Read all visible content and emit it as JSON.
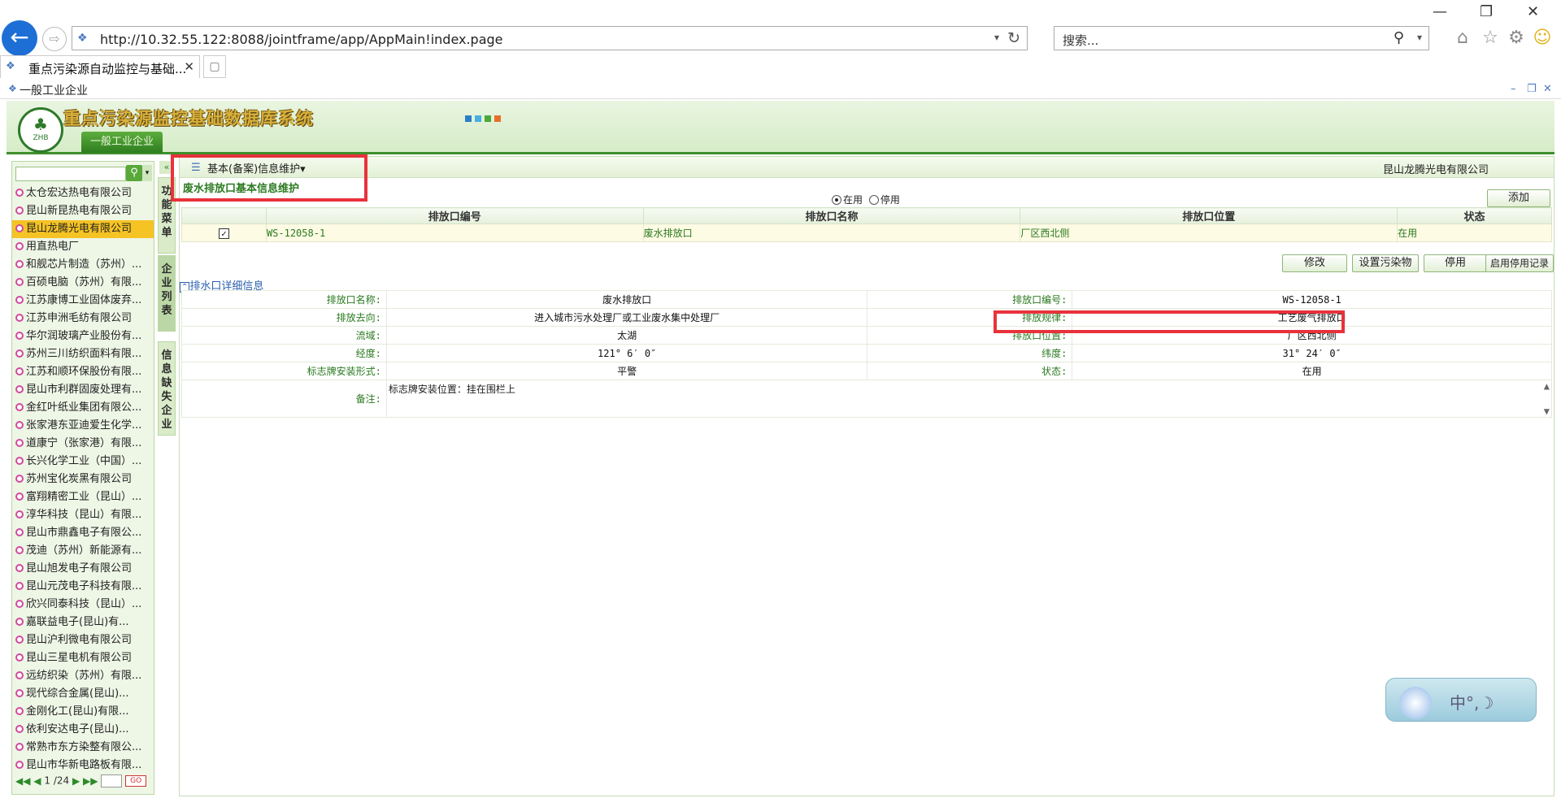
{
  "browser": {
    "url": "http://10.32.55.122:8088/jointframe/app/AppMain!index.page",
    "search_placeholder": "搜索...",
    "tab_title": "重点污染源自动监控与基础...",
    "back_glyph": "←",
    "forward_glyph": "⇨"
  },
  "app": {
    "window_title": "一般工业企业",
    "system_title": "重点污染源监控基础数据库系统",
    "logo_text": "ZHB",
    "module_tab": "一般工业企业"
  },
  "sidebar": {
    "items": [
      {
        "label": "太仓宏达热电有限公司"
      },
      {
        "label": "昆山新昆热电有限公司"
      },
      {
        "label": "昆山龙腾光电有限公司",
        "selected": true
      },
      {
        "label": "用直热电厂"
      },
      {
        "label": "和舰芯片制造（苏州）..."
      },
      {
        "label": "百硕电脑（苏州）有限..."
      },
      {
        "label": "江苏康博工业固体废弃..."
      },
      {
        "label": "江苏申洲毛纺有限公司"
      },
      {
        "label": "华尔润玻璃产业股份有..."
      },
      {
        "label": "苏州三川纺织面料有限..."
      },
      {
        "label": "江苏和顺环保股份有限..."
      },
      {
        "label": "昆山市利群固废处理有..."
      },
      {
        "label": "金红叶纸业集团有限公..."
      },
      {
        "label": "张家港东亚迪爱生化学..."
      },
      {
        "label": "道康宁（张家港）有限..."
      },
      {
        "label": "长兴化学工业（中国）..."
      },
      {
        "label": "苏州宝化炭黑有限公司"
      },
      {
        "label": "富翔精密工业（昆山）..."
      },
      {
        "label": "淳华科技（昆山）有限..."
      },
      {
        "label": "昆山市鼎鑫电子有限公..."
      },
      {
        "label": "茂迪（苏州）新能源有..."
      },
      {
        "label": "昆山旭发电子有限公司"
      },
      {
        "label": "昆山元茂电子科技有限..."
      },
      {
        "label": "欣兴同泰科技（昆山）..."
      },
      {
        "label": "嘉联益电子(昆山)有..."
      },
      {
        "label": "昆山沪利微电有限公司"
      },
      {
        "label": "昆山三星电机有限公司"
      },
      {
        "label": "远纺织染（苏州）有限..."
      },
      {
        "label": "现代综合金属(昆山)..."
      },
      {
        "label": "金刚化工(昆山)有限..."
      },
      {
        "label": "依利安达电子(昆山)..."
      },
      {
        "label": "常熟市东方染整有限公..."
      },
      {
        "label": "昆山市华新电路板有限..."
      }
    ],
    "pager": {
      "current": "1",
      "total": "/24",
      "go": "GO"
    }
  },
  "vtabs": {
    "func_menu": "功能菜单",
    "company_list": "企业列表",
    "missing_info": "信息缺失企业",
    "collapse": "«"
  },
  "main": {
    "menu_label": "基本(备案)信息维护▾",
    "company": "昆山龙腾光电有限公司",
    "subtitle": "废水排放口基本信息维护",
    "radio_in_use": "在用",
    "radio_disabled": "停用",
    "add_button": "添加",
    "grid": {
      "headers": [
        "排放口编号",
        "排放口名称",
        "排放口位置",
        "状态"
      ],
      "rows": [
        {
          "code": "WS-12058-1",
          "name": "废水排放口",
          "location": "厂区西北侧",
          "status": "在用",
          "checked": "✓"
        }
      ]
    },
    "actions": {
      "edit": "修改",
      "set_pollutant": "设置污染物",
      "disable": "停用",
      "history": "启用停用记录"
    },
    "detail_title": "排水口详细信息",
    "detail": {
      "name_label": "排放口名称:",
      "name_value": "废水排放口",
      "code_label": "排放口编号:",
      "code_value": "WS-12058-1",
      "dest_label": "排放去向:",
      "dest_value": "进入城市污水处理厂或工业废水集中处理厂",
      "rule_label": "排放规律:",
      "rule_value": "工艺废气排放口",
      "basin_label": "流域:",
      "basin_value": "太湖",
      "loc_label": "排放口位置:",
      "loc_value": "厂区西北侧",
      "lon_label": "经度:",
      "lon_value": "121° 6′ 0″",
      "lat_label": "纬度:",
      "lat_value": "31° 24′ 0″",
      "sign_label": "标志牌安装形式:",
      "sign_value": "平警",
      "status_label": "状态:",
      "status_value": "在用",
      "memo_label": "备注:",
      "memo_value": "标志牌安装位置：挂在围栏上"
    }
  },
  "ime": {
    "text": "中°,☽"
  },
  "colors": {
    "accent_green": "#2a7a1f",
    "highlight_red": "#e8323b",
    "selected_yellow": "#f6c324"
  }
}
